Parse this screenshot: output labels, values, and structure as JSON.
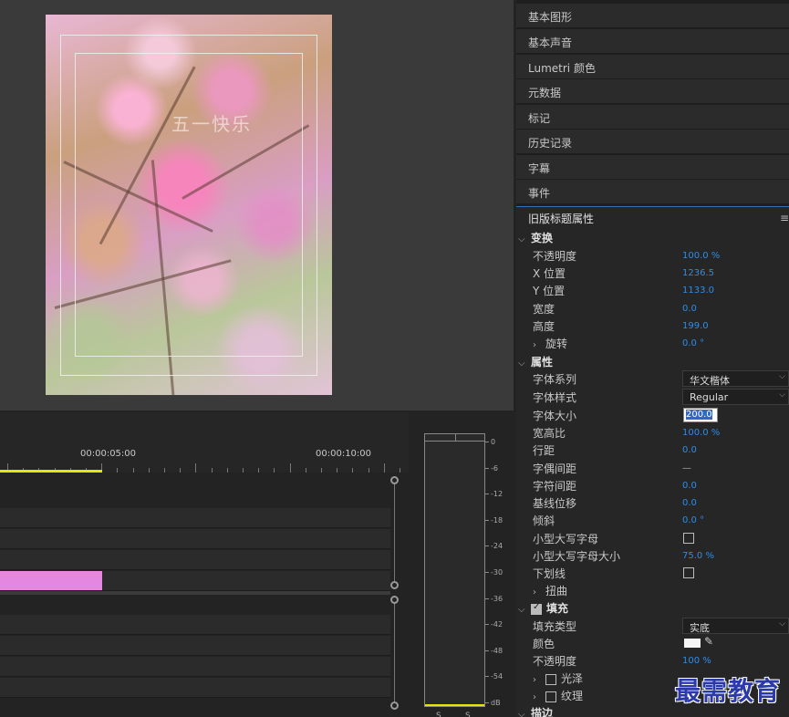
{
  "monitor": {
    "title_overlay": "五一快乐"
  },
  "timeline": {
    "ruler_labels": [
      "00:00:05:00",
      "00:00:10:00"
    ],
    "clip_color": "#e487e1",
    "playhead_color": "#e6e600"
  },
  "meter": {
    "db_labels": [
      "0",
      "-6",
      "-12",
      "-18",
      "-24",
      "-30",
      "-36",
      "-42",
      "-48",
      "-54",
      "dB"
    ],
    "solo_labels": [
      "S",
      "S"
    ]
  },
  "panels": {
    "collapsed": [
      "基本图形",
      "基本声音",
      "Lumetri 颜色",
      "元数据",
      "标记",
      "历史记录",
      "字幕",
      "事件"
    ]
  },
  "legacy_title": {
    "header": "旧版标题属性",
    "menu_icon": "≡",
    "transform": {
      "label": "变换",
      "rows": [
        {
          "label": "不透明度",
          "value": "100.0 %"
        },
        {
          "label": "X 位置",
          "value": "1236.5"
        },
        {
          "label": "Y 位置",
          "value": "1133.0"
        },
        {
          "label": "宽度",
          "value": "0.0"
        },
        {
          "label": "高度",
          "value": "199.0"
        },
        {
          "label": "旋转",
          "value": "0.0 °"
        }
      ]
    },
    "properties": {
      "label": "属性",
      "font_family_label": "字体系列",
      "font_family_value": "华文楷体",
      "font_style_label": "字体样式",
      "font_style_value": "Regular",
      "font_size_label": "字体大小",
      "font_size_value": "200.0",
      "rows": [
        {
          "label": "宽高比",
          "value": "100.0 %"
        },
        {
          "label": "行距",
          "value": "0.0"
        },
        {
          "label": "字偶间距",
          "value": "—"
        },
        {
          "label": "字符间距",
          "value": "0.0"
        },
        {
          "label": "基线位移",
          "value": "0.0"
        },
        {
          "label": "倾斜",
          "value": "0.0 °"
        }
      ],
      "small_caps_label": "小型大写字母",
      "small_caps_size_label": "小型大写字母大小",
      "small_caps_size_value": "75.0 %",
      "underline_label": "下划线",
      "distort_label": "扭曲"
    },
    "fill": {
      "label": "填充",
      "fill_type_label": "填充类型",
      "fill_type_value": "实底",
      "color_label": "颜色",
      "color_value": "#f5f5f5",
      "opacity_label": "不透明度",
      "opacity_value": "100 %",
      "sheen_label": "光泽",
      "texture_label": "纹理"
    },
    "stroke_label": "描边"
  },
  "watermark": "最需教育"
}
